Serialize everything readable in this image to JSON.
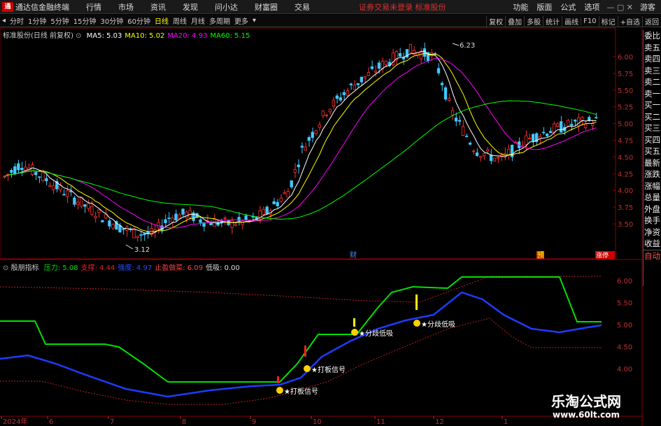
{
  "app": {
    "logo": "通",
    "title": "通达信金融终端",
    "menu": [
      "行情",
      "市场",
      "资讯",
      "发现",
      "问小达",
      "财富圈",
      "交易"
    ],
    "login_tip": "证券交易未登录",
    "stock_short": "标准股份",
    "right_menu": [
      "功能",
      "版面",
      "公式",
      "选项"
    ],
    "guest": "游客"
  },
  "toolbar": {
    "periods": [
      "分时",
      "1分钟",
      "5分钟",
      "15分钟",
      "30分钟",
      "60分钟",
      "日线",
      "周线",
      "月线",
      "多周期",
      "更多"
    ],
    "active": "日线",
    "right": [
      "复权",
      "叠加",
      "多股",
      "统计",
      "画线",
      "F10",
      "标记",
      "+自选",
      "返回"
    ]
  },
  "main": {
    "stock_label": "标准股份(日线 前复权)",
    "ma": [
      {
        "label": "MA5: 5.03",
        "color": "#ffffff"
      },
      {
        "label": "MA10: 5.02",
        "color": "#ffff00"
      },
      {
        "label": "MA20: 4.93",
        "color": "#ff00ff"
      },
      {
        "label": "MA60: 5.15",
        "color": "#00ff00"
      }
    ],
    "price_axis": [
      "6.00",
      "5.75",
      "5.50",
      "5.25",
      "5.00",
      "4.75",
      "4.50",
      "4.25",
      "4.00",
      "3.75",
      "3.50"
    ],
    "high_label": "6.23",
    "low_label": "3.12",
    "events": {
      "cai": "财",
      "yu": "预",
      "zt": "涨停"
    }
  },
  "indicator": {
    "name": "殷朋指标",
    "items": [
      {
        "label": "压力: 5.08",
        "color": "#00e000"
      },
      {
        "label": "支撑: 4.44",
        "color": "#e02020"
      },
      {
        "label": "强度: 4.97",
        "color": "#2a4bff"
      },
      {
        "label": "止盈做菜: 6.09",
        "color": "#ff4040"
      },
      {
        "label": "低吸: 0.00",
        "color": "#dddddd"
      }
    ],
    "axis": [
      "6.00",
      "5.50",
      "5.00",
      "4.50",
      "4.00"
    ],
    "signals": [
      "打板信号",
      "打板信号",
      "分歧低吸",
      "分歧低吸"
    ]
  },
  "x_axis": [
    "2024年",
    "6",
    "7",
    "8",
    "9",
    "10",
    "11",
    "12",
    "1"
  ],
  "sidebar": [
    "委比",
    "卖五",
    "卖四",
    "卖三",
    "卖二",
    "卖一",
    "买一",
    "买二",
    "买三",
    "买四",
    "买五",
    "最新",
    "涨跌",
    "涨幅",
    "总量",
    "外盘",
    "换手",
    "净资",
    "收益",
    "自动"
  ],
  "watermark": {
    "title": "乐淘公式网",
    "url": "www.60lt.com"
  }
}
